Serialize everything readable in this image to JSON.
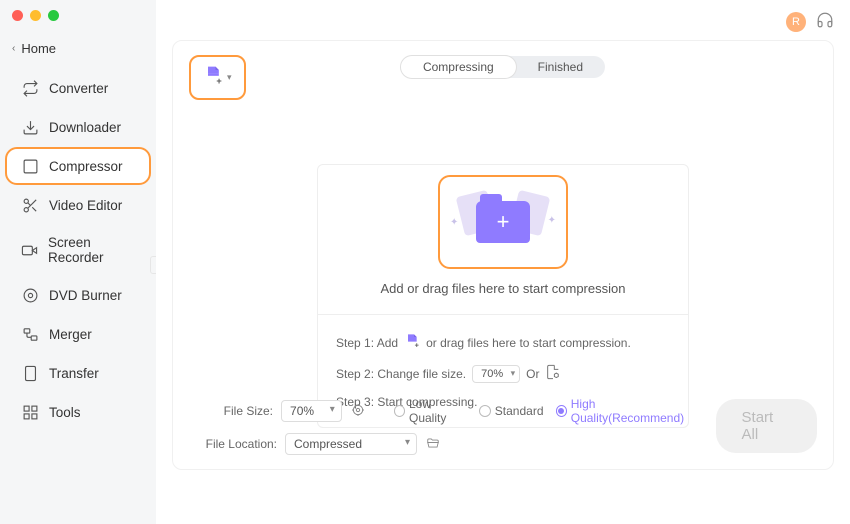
{
  "sidebar": {
    "home_label": "Home",
    "items": [
      {
        "label": "Converter"
      },
      {
        "label": "Downloader"
      },
      {
        "label": "Compressor"
      },
      {
        "label": "Video Editor"
      },
      {
        "label": "Screen Recorder"
      },
      {
        "label": "DVD Burner"
      },
      {
        "label": "Merger"
      },
      {
        "label": "Transfer"
      },
      {
        "label": "Tools"
      }
    ]
  },
  "tabs": {
    "compressing": "Compressing",
    "finished": "Finished"
  },
  "dropzone": {
    "text": "Add or drag files here to start compression"
  },
  "steps": {
    "step1_prefix": "Step 1: Add",
    "step1_suffix": "or drag files here to start compression.",
    "step2_prefix": "Step 2: Change file size.",
    "step2_value": "70%",
    "step2_or": "Or",
    "step3": "Step 3: Start compressing."
  },
  "bottom": {
    "file_size_label": "File Size:",
    "file_size_value": "70%",
    "file_location_label": "File Location:",
    "file_location_value": "Compressed",
    "quality": {
      "low": "Low Quality",
      "standard": "Standard",
      "high": "High Quality(Recommend)"
    },
    "start_all": "Start All"
  },
  "header": {
    "avatar_initial": "R"
  }
}
